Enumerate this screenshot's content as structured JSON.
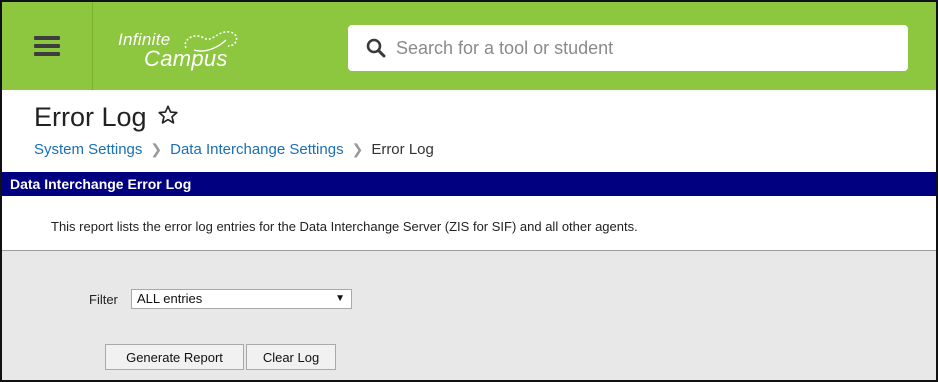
{
  "header": {
    "logo_line1": "Infinite",
    "logo_line2": "Campus",
    "search_placeholder": "Search for a tool or student",
    "accent_color": "#8dc63f"
  },
  "page": {
    "title": "Error Log",
    "breadcrumb": [
      {
        "label": "System Settings",
        "link": true
      },
      {
        "label": "Data Interchange Settings",
        "link": true
      },
      {
        "label": "Error Log",
        "link": false
      }
    ]
  },
  "section": {
    "title": "Data Interchange Error Log",
    "description": "This report lists the error log entries for the Data Interchange Server (ZIS for SIF) and all other agents.",
    "bar_color": "#000080"
  },
  "form": {
    "filter_label": "Filter",
    "filter_value": "ALL entries",
    "generate_label": "Generate Report",
    "clear_label": "Clear Log"
  }
}
